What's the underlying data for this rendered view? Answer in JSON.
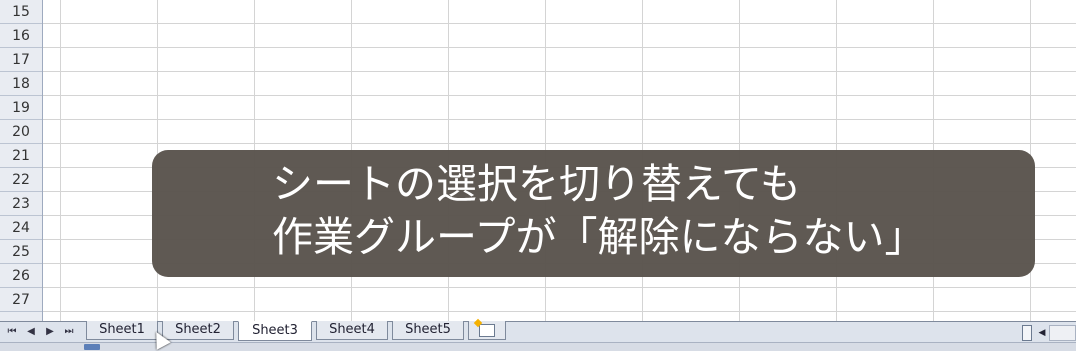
{
  "rows": [
    "15",
    "16",
    "17",
    "18",
    "19",
    "20",
    "21",
    "22",
    "23",
    "24",
    "25",
    "26",
    "27"
  ],
  "sheet_tabs": [
    {
      "label": "Sheet1",
      "active": false
    },
    {
      "label": "Sheet2",
      "active": false
    },
    {
      "label": "Sheet3",
      "active": true
    },
    {
      "label": "Sheet4",
      "active": false
    },
    {
      "label": "Sheet5",
      "active": false
    }
  ],
  "nav": {
    "first": "⏮",
    "prev": "◀",
    "next": "▶",
    "last": "⏭"
  },
  "overlay": {
    "line1": "シートの選択を切り替えても",
    "line2": "作業グループが「解除にならない」"
  },
  "icons": {
    "new_sheet": "insert-worksheet-icon",
    "cursor": "mouse-pointer-icon"
  },
  "colors": {
    "overlay_bg": "#58524c",
    "tab_active": "#ffffff",
    "tab_bar": "#dde3ec"
  }
}
